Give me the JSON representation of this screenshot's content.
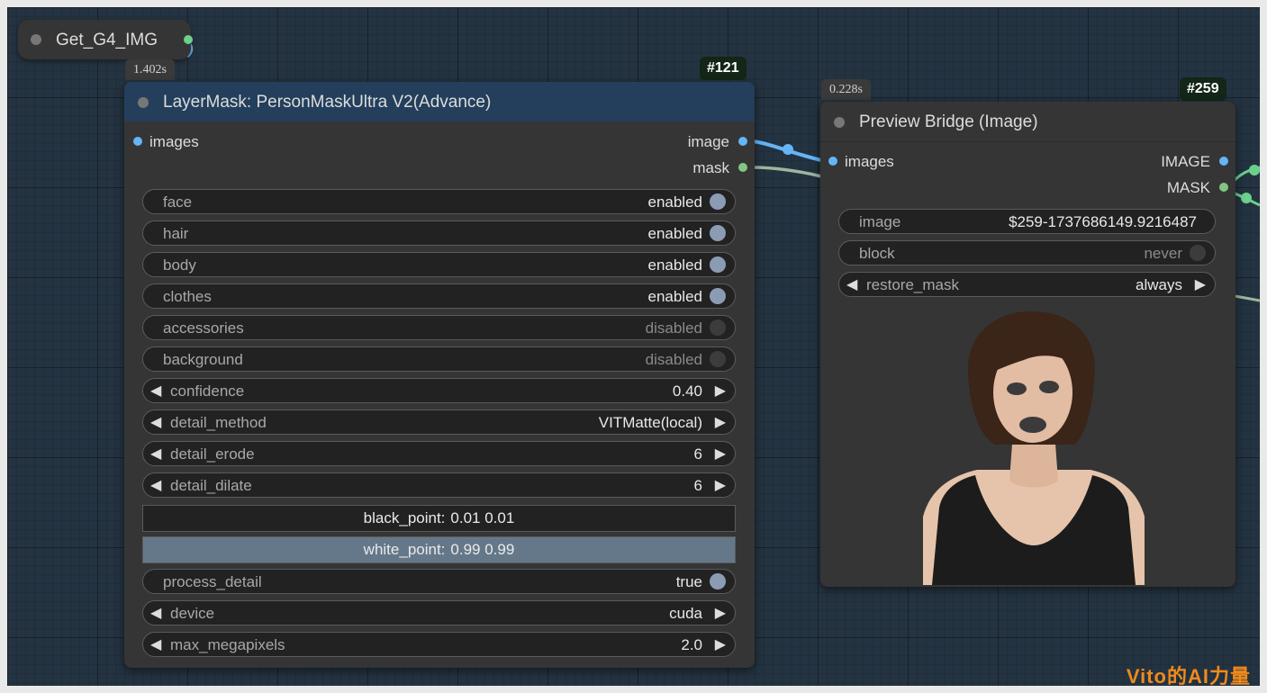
{
  "get_node": {
    "title": "Get_G4_IMG"
  },
  "layermask_node": {
    "time": "1.402s",
    "id": "#121",
    "title": "LayerMask: PersonMaskUltra V2(Advance)",
    "header_color": "#233f5b",
    "inputs": [
      {
        "label": "images",
        "color": "#64b5f6"
      }
    ],
    "outputs": [
      {
        "label": "image",
        "color": "#64b5f6"
      },
      {
        "label": "mask",
        "color": "#81c784"
      }
    ],
    "toggles": [
      {
        "label": "face",
        "value": "enabled",
        "on": true
      },
      {
        "label": "hair",
        "value": "enabled",
        "on": true
      },
      {
        "label": "body",
        "value": "enabled",
        "on": true
      },
      {
        "label": "clothes",
        "value": "enabled",
        "on": true
      },
      {
        "label": "accessories",
        "value": "disabled",
        "on": false
      },
      {
        "label": "background",
        "value": "disabled",
        "on": false
      }
    ],
    "combos": [
      {
        "label": "confidence",
        "value": "0.40"
      },
      {
        "label": "detail_method",
        "value": "VITMatte(local)"
      },
      {
        "label": "detail_erode",
        "value": "6"
      },
      {
        "label": "detail_dilate",
        "value": "6"
      }
    ],
    "black_point": {
      "label": "black_point:",
      "value": "0.01  0.01"
    },
    "white_point": {
      "label": "white_point:",
      "value": "0.99  0.99"
    },
    "process_detail": {
      "label": "process_detail",
      "value": "true",
      "on": true
    },
    "combos2": [
      {
        "label": "device",
        "value": "cuda"
      },
      {
        "label": "max_megapixels",
        "value": "2.0"
      }
    ]
  },
  "preview_node": {
    "time": "0.228s",
    "id": "#259",
    "title": "Preview Bridge (Image)",
    "inputs": [
      {
        "label": "images",
        "color": "#64b5f6"
      }
    ],
    "outputs": [
      {
        "label": "IMAGE",
        "color": "#64b5f6"
      },
      {
        "label": "MASK",
        "color": "#81c784"
      }
    ],
    "image_widget": {
      "label": "image",
      "value": "$259-1737686149.9216487"
    },
    "block_widget": {
      "label": "block",
      "value": "never",
      "on": false
    },
    "restore_mask": {
      "label": "restore_mask",
      "value": "always"
    }
  },
  "colors": {
    "image_link": "#64b5f6",
    "mask_link": "#9fb59f",
    "accent_green": "#6cd08b"
  },
  "watermark": "Vito的AI力量"
}
